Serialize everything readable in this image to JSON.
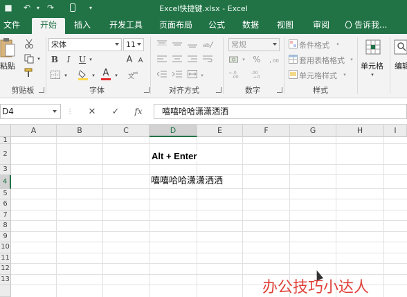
{
  "window": {
    "title": "Excel快捷键.xlsx - Excel"
  },
  "quick_access": {
    "undo_glyph": "↶",
    "redo_glyph": "↷",
    "more_glyph": "▾",
    "save_glyph": "■"
  },
  "tabs": [
    {
      "label": "文件"
    },
    {
      "label": "开始"
    },
    {
      "label": "插入"
    },
    {
      "label": "开发工具"
    },
    {
      "label": "页面布局"
    },
    {
      "label": "公式"
    },
    {
      "label": "数据"
    },
    {
      "label": "视图"
    },
    {
      "label": "审阅"
    }
  ],
  "tell_me": "告诉我...",
  "ribbon": {
    "clipboard": {
      "paste_label": "粘贴",
      "group_label": "剪贴板"
    },
    "font": {
      "name": "宋体",
      "size": "11",
      "bold": "B",
      "italic": "I",
      "underline": "U",
      "font_color": "A",
      "grow": "A",
      "shrink": "A",
      "group_label": "字体"
    },
    "alignment": {
      "group_label": "对齐方式"
    },
    "number": {
      "format": "常规",
      "percent": "%",
      "group_label": "数字"
    },
    "styles": {
      "conditional": "条件格式",
      "as_table": "套用表格格式",
      "cell_styles": "单元格样式",
      "group_label": "样式"
    },
    "cells": {
      "label": "单元格"
    },
    "editing": {
      "label": "编辑"
    }
  },
  "formula_bar": {
    "name_box": "D4",
    "cancel": "✕",
    "enter": "✓",
    "fx": "fx",
    "content": "嘻嘻哈哈潇潇洒洒"
  },
  "sheet": {
    "columns": [
      "A",
      "B",
      "C",
      "D",
      "E",
      "F",
      "G",
      "H",
      "I"
    ],
    "rows": [
      "1",
      "2",
      "3",
      "4",
      "5",
      "6",
      "7",
      "8",
      "9",
      "10",
      "11",
      "12",
      "13"
    ],
    "selected_cell": "D4",
    "cell_D2": "Alt + Enter",
    "cell_D4": "嘻嘻哈哈潇潇洒洒"
  },
  "watermark": "办公技巧小达人",
  "colors": {
    "brand": "#217346",
    "watermark": "#e0413a"
  }
}
